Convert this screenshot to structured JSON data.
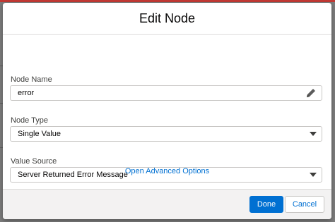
{
  "modal": {
    "title": "Edit Node",
    "fields": {
      "node_name": {
        "label": "Node Name",
        "value": "error"
      },
      "node_type": {
        "label": "Node Type",
        "value": "Single Value"
      },
      "value_source": {
        "label": "Value Source",
        "value": "Server Returned Error Message"
      }
    },
    "advanced_link": "Open Advanced Options",
    "footer": {
      "done_label": "Done",
      "cancel_label": "Cancel"
    }
  },
  "colors": {
    "brand": "#0070d2",
    "backdrop": "#7b7b7b",
    "footer_bg": "#f3f2f2"
  },
  "icons": {
    "edit": "pencil-icon",
    "dropdown": "chevron-down-icon"
  }
}
